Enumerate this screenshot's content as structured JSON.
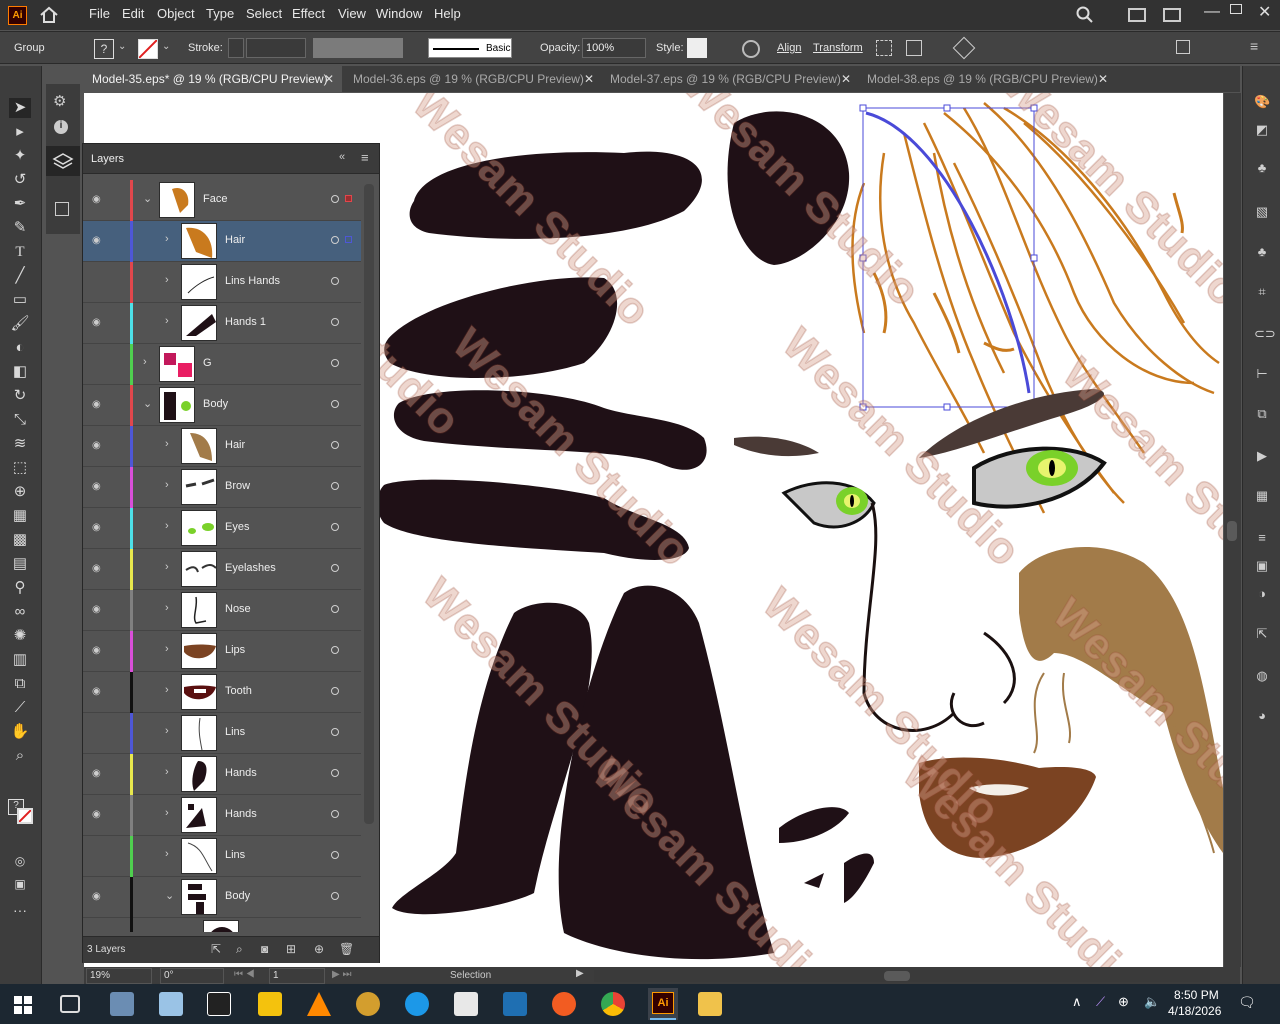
{
  "app": {
    "logo": "Ai"
  },
  "menubar": {
    "items": [
      "File",
      "Edit",
      "Object",
      "Type",
      "Select",
      "Effect",
      "View",
      "Window",
      "Help"
    ]
  },
  "control": {
    "selection_type": "Group",
    "stroke_label": "Stroke:",
    "brush_label": "Basic",
    "opacity_label": "Opacity:",
    "opacity_value": "100%",
    "style_label": "Style:",
    "align_label": "Align",
    "transform_label": "Transform"
  },
  "tabs": [
    {
      "label": "Model-35.eps* @ 19 % (RGB/CPU Preview)",
      "active": true
    },
    {
      "label": "Model-36.eps @ 19 % (RGB/CPU Preview)",
      "active": false
    },
    {
      "label": "Model-37.eps @ 19 % (RGB/CPU Preview)",
      "active": false
    },
    {
      "label": "Model-38.eps @ 19 % (RGB/CPU Preview)",
      "active": false
    }
  ],
  "layers_panel": {
    "title": "Layers",
    "count_label": "3 Layers",
    "rows": [
      {
        "name": "Face",
        "level": 0,
        "expanded": true,
        "visible": true,
        "color": "#e0474c",
        "selected": false
      },
      {
        "name": "Hair",
        "level": 1,
        "expanded": false,
        "visible": true,
        "color": "#4e57d6",
        "selected": true
      },
      {
        "name": "Lins Hands",
        "level": 1,
        "expanded": false,
        "visible": false,
        "color": "#e0474c",
        "selected": false
      },
      {
        "name": "Hands 1",
        "level": 1,
        "expanded": false,
        "visible": true,
        "color": "#4de0e8",
        "selected": false
      },
      {
        "name": "G",
        "level": 0,
        "expanded": false,
        "visible": false,
        "color": "#4fcf4f",
        "selected": false
      },
      {
        "name": "Body",
        "level": 0,
        "expanded": true,
        "visible": true,
        "color": "#e0474c",
        "selected": false
      },
      {
        "name": "Hair",
        "level": 1,
        "expanded": false,
        "visible": true,
        "color": "#4e57d6",
        "selected": false
      },
      {
        "name": "Brow",
        "level": 1,
        "expanded": false,
        "visible": true,
        "color": "#d94fd9",
        "selected": false
      },
      {
        "name": "Eyes",
        "level": 1,
        "expanded": false,
        "visible": true,
        "color": "#4de0e8",
        "selected": false
      },
      {
        "name": "Eyelashes",
        "level": 1,
        "expanded": false,
        "visible": true,
        "color": "#e8e84d",
        "selected": false
      },
      {
        "name": "Nose",
        "level": 1,
        "expanded": false,
        "visible": true,
        "color": "#808080",
        "selected": false
      },
      {
        "name": "Lips",
        "level": 1,
        "expanded": false,
        "visible": true,
        "color": "#d94fd9",
        "selected": false
      },
      {
        "name": "Tooth",
        "level": 1,
        "expanded": false,
        "visible": true,
        "color": "#111111",
        "selected": false
      },
      {
        "name": "Lins",
        "level": 1,
        "expanded": false,
        "visible": true,
        "color": "#4e57d6",
        "selected": false
      },
      {
        "name": "Hands",
        "level": 1,
        "expanded": false,
        "visible": true,
        "color": "#e8e84d",
        "selected": false
      },
      {
        "name": "Hands",
        "level": 1,
        "expanded": false,
        "visible": true,
        "color": "#808080",
        "selected": false
      },
      {
        "name": "Lins",
        "level": 1,
        "expanded": false,
        "visible": true,
        "color": "#4fcf4f",
        "selected": false
      },
      {
        "name": "Body",
        "level": 1,
        "expanded": true,
        "visible": true,
        "color": "#111111",
        "selected": false
      }
    ]
  },
  "watermark": {
    "text": "Wesam Studio"
  },
  "status": {
    "zoom": "19%",
    "rotation": "0°",
    "artboard": "1",
    "tool": "Selection"
  },
  "taskbar": {
    "time": "8:50 PM",
    "date": "4/18/2026"
  },
  "colors": {
    "accent": "#ff9a00",
    "selection": "#4a4ad8",
    "hair": "#c97a1e",
    "silhouette": "#1f1016"
  }
}
